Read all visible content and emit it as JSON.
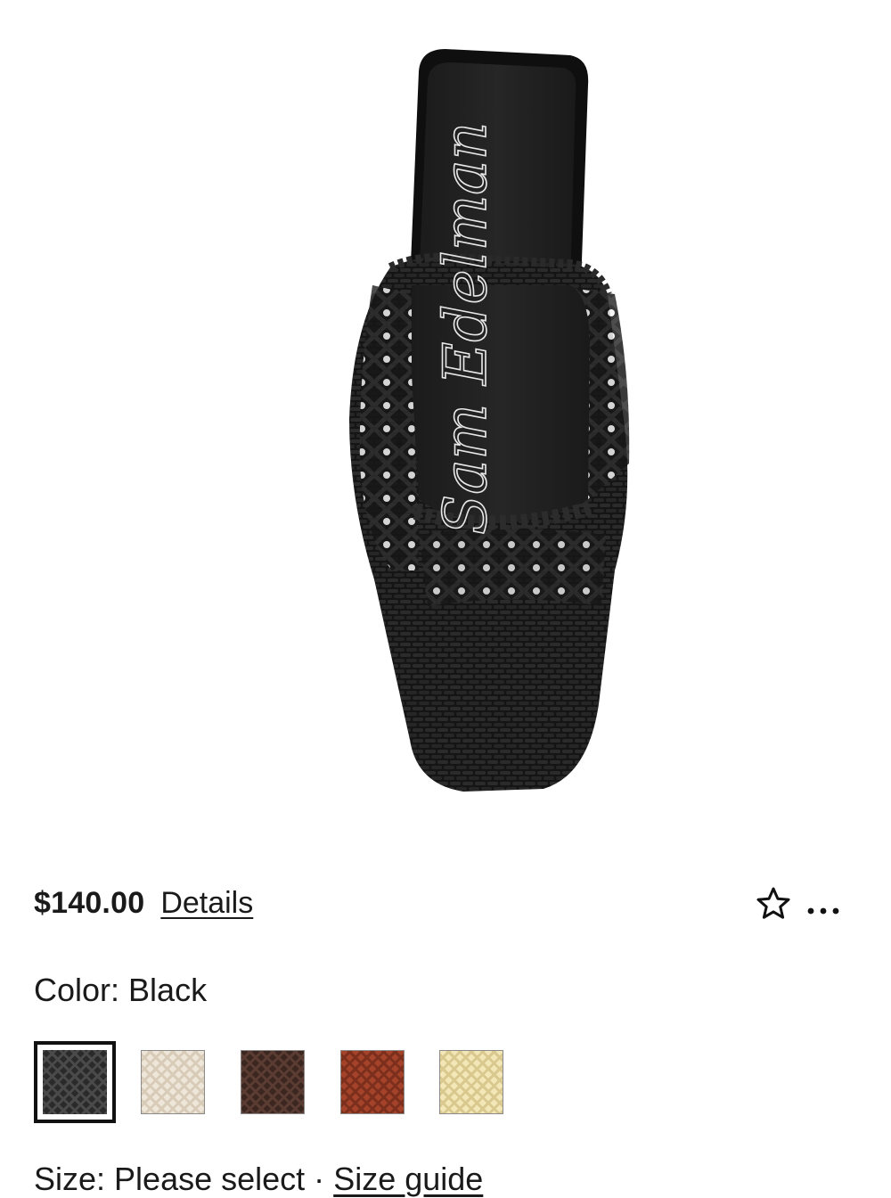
{
  "product": {
    "image_alt": "Black woven leather mule, top view",
    "insole_brand_script": "Sam Edelman",
    "price": "$140.00",
    "details_label": "Details",
    "actions": {
      "wishlist_icon": "star-outline-icon",
      "more_icon": "ellipsis-icon"
    }
  },
  "color": {
    "label": "Color: Black",
    "swatches": [
      {
        "name": "Black",
        "color": "#2a2a2a",
        "weave": "#4a4a4a",
        "selected": true
      },
      {
        "name": "Ivory",
        "color": "#efe6da",
        "weave": "#d8cbb8",
        "selected": false
      },
      {
        "name": "Dark Brown",
        "color": "#3b2620",
        "weave": "#5a3c33",
        "selected": false
      },
      {
        "name": "Cognac",
        "color": "#a5432a",
        "weave": "#7c2f1c",
        "selected": false
      },
      {
        "name": "Cream",
        "color": "#f3e7b8",
        "weave": "#d9c98f",
        "selected": false
      }
    ]
  },
  "size": {
    "label": "Size: Please select",
    "separator": "·",
    "guide_label": "Size guide"
  }
}
